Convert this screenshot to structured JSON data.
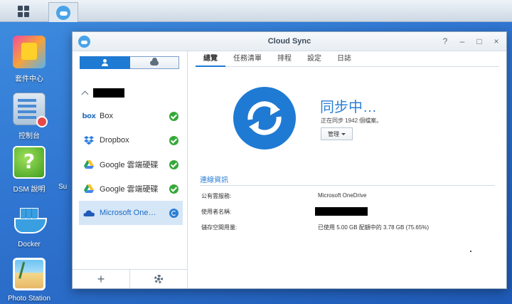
{
  "window": {
    "title": "Cloud Sync",
    "controls": [
      "?",
      "–",
      "□",
      "×"
    ]
  },
  "desktop": {
    "icons": [
      {
        "label": "套件中心",
        "icon": "package-center-icon"
      },
      {
        "label": "控制台",
        "icon": "control-panel-icon"
      },
      {
        "label": "DSM 說明",
        "icon": "help-icon"
      },
      {
        "label": "Docker",
        "icon": "docker-icon"
      },
      {
        "label": "Photo Station",
        "icon": "photo-station-icon"
      }
    ],
    "truncated_label": "Su"
  },
  "sidebar": {
    "tasks": [
      {
        "label": "Box",
        "icon": "box-icon",
        "status": "ok"
      },
      {
        "label": "Dropbox",
        "icon": "dropbox-icon",
        "status": "ok"
      },
      {
        "label": "Google 雲端硬碟",
        "icon": "google-drive-icon",
        "status": "ok"
      },
      {
        "label": "Google 雲端硬碟",
        "icon": "google-drive-icon",
        "status": "ok"
      },
      {
        "label": "Microsoft One…",
        "icon": "onedrive-icon",
        "status": "syncing"
      }
    ],
    "add_label": "+"
  },
  "tabs": [
    "總覽",
    "任務清單",
    "排程",
    "設定",
    "日誌"
  ],
  "status": {
    "title": "同步中…",
    "subtitle": "正在同步 1942 個檔案。",
    "manage_label": "管理"
  },
  "connection": {
    "section_title": "連線資訊",
    "rows": [
      {
        "label": "公有雲服務:",
        "value": "Microsoft OneDrive"
      },
      {
        "label": "使用者名稱:",
        "value": ""
      },
      {
        "label": "儲存空間用量:",
        "value": "已使用 5.00 GB 配額中的 3.78 GB (75.65%)"
      }
    ]
  },
  "colors": {
    "accent": "#1f7ad3",
    "ok": "#36a839",
    "desktop_bg": "#2f74d0"
  }
}
